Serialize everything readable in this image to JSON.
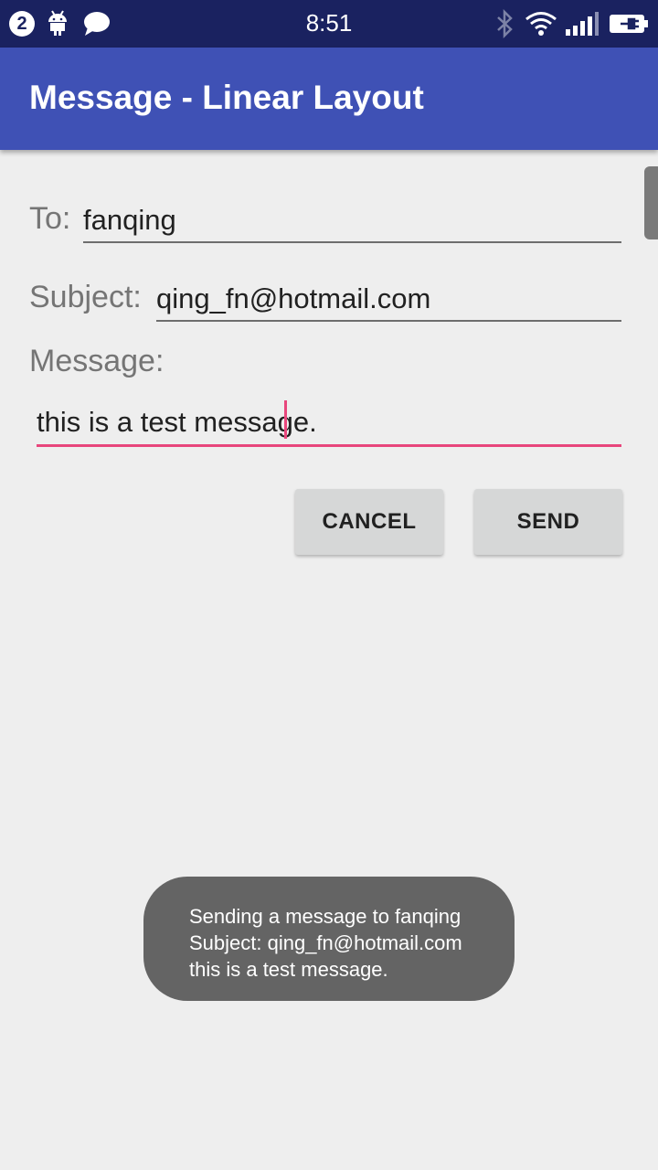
{
  "status_bar": {
    "notification_count": "2",
    "time": "8:51",
    "icons": [
      "android-icon",
      "chat-bubble-icon",
      "bluetooth-icon",
      "wifi-icon",
      "signal-icon",
      "battery-charging-icon"
    ]
  },
  "app_bar": {
    "title": "Message - Linear Layout",
    "color": "#3f51b5"
  },
  "form": {
    "to_label": "To:",
    "to_value": "fanqing",
    "subject_label": "Subject:",
    "subject_value": "qing_fn@hotmail.com",
    "message_label": "Message:",
    "message_value": "this is a test message."
  },
  "buttons": {
    "cancel_label": "CANCEL",
    "send_label": "SEND"
  },
  "toast": {
    "lines": [
      "Sending a message to fanqing",
      "Subject: qing_fn@hotmail.com",
      "this is a test message."
    ]
  },
  "colors": {
    "accent": "#e8467c",
    "status_bar": "#1a2260",
    "background": "#eeeeee"
  }
}
